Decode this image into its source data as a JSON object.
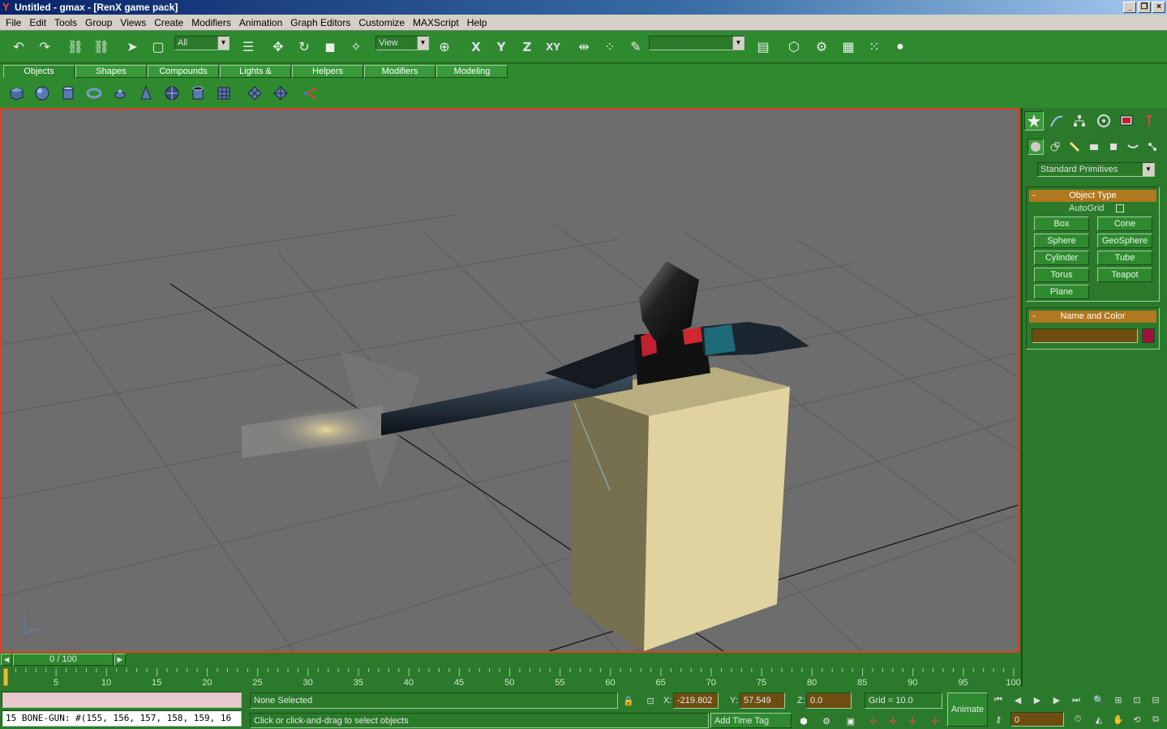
{
  "window": {
    "title": "Untitled - gmax - [RenX game pack]"
  },
  "menu": [
    "File",
    "Edit",
    "Tools",
    "Group",
    "Views",
    "Create",
    "Modifiers",
    "Animation",
    "Graph Editors",
    "Customize",
    "MAXScript",
    "Help"
  ],
  "toolbar": {
    "selection_filter": "All",
    "reference_coord": "View",
    "axis_x": "X",
    "axis_y": "Y",
    "axis_z": "Z",
    "axis_xy": "XY",
    "named_selection": ""
  },
  "tabs": [
    "Objects",
    "Shapes",
    "Compounds",
    "Lights & Cameras",
    "Helpers",
    "Modifiers",
    "Modeling"
  ],
  "panel": {
    "category": "Standard Primitives",
    "object_type_title": "Object Type",
    "autogrid_label": "AutoGrid",
    "buttons": [
      "Box",
      "Cone",
      "Sphere",
      "GeoSphere",
      "Cylinder",
      "Tube",
      "Torus",
      "Teapot",
      "Plane"
    ],
    "name_color_title": "Name and Color",
    "object_name": "",
    "object_color": "#a01040"
  },
  "timeline": {
    "frame_display": "0 / 100",
    "ticks": [
      "5",
      "10",
      "15",
      "20",
      "25",
      "30",
      "35",
      "40",
      "45",
      "50",
      "55",
      "60",
      "65",
      "70",
      "75",
      "80",
      "85",
      "90",
      "95",
      "100"
    ]
  },
  "status": {
    "maxscript_output": "15 BONE-GUN: #(155, 156, 157, 158, 159, 16",
    "selection": "None Selected",
    "prompt": "Click or click-and-drag to select objects",
    "x_label": "X:",
    "x_value": "-219.802",
    "y_label": "Y:",
    "y_value": "57.549",
    "z_label": "Z:",
    "z_value": "0.0",
    "grid": "Grid = 10.0",
    "add_time_tag": "Add Time Tag",
    "animate": "Animate",
    "current_frame": "0"
  },
  "colors": {
    "ui_green": "#2f8a2f",
    "rollout_header": "#b07820",
    "viewport_border": "#e04020"
  }
}
